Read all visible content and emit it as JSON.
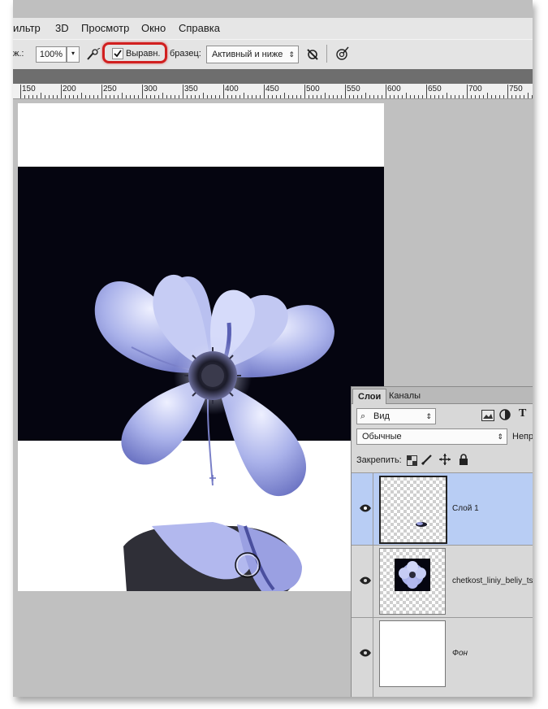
{
  "menu": {
    "items": [
      {
        "label": "ильтр"
      },
      {
        "label": "3D"
      },
      {
        "label": "Просмотр"
      },
      {
        "label": "Окно"
      },
      {
        "label": "Справка"
      }
    ]
  },
  "options": {
    "opacity_label": "ж.:",
    "opacity_value": "100%",
    "aligned_label": "Выравн.",
    "aligned_checked": true,
    "sample_label": "бразец:",
    "sample_value": "Активный и ниже"
  },
  "ruler": {
    "labels": [
      "150",
      "200",
      "250",
      "300",
      "350",
      "400",
      "450",
      "500",
      "550",
      "600",
      "650",
      "700",
      "750"
    ]
  },
  "colors": {
    "highlight": "#d11f1f",
    "selected_layer": "#b8cdf4",
    "canvas_bg": "#c0c0c0"
  },
  "layers_panel": {
    "tabs": [
      "Слои",
      "Каналы"
    ],
    "filter_value": "Вид",
    "blend_mode": "Обычные",
    "opacity_label": "Непр",
    "lock_label": "Закрепить:",
    "layers": [
      {
        "name": "Слой 1",
        "selected": true,
        "visible": true
      },
      {
        "name": "chetkost_liniy_beliy_ts",
        "selected": false,
        "visible": true
      },
      {
        "name": "Фон",
        "selected": false,
        "visible": true
      }
    ]
  }
}
